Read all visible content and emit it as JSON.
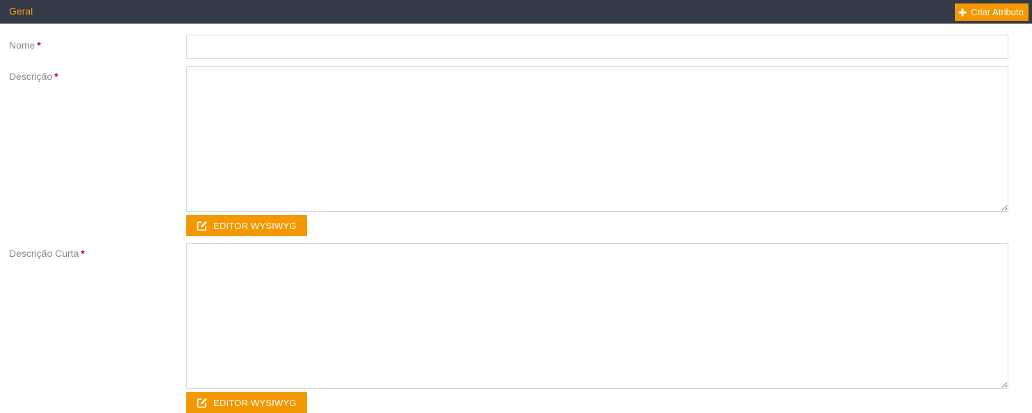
{
  "section": {
    "title": "Geral",
    "create_button_label": "Criar Atributo",
    "create_button_icon": "plus-icon"
  },
  "form": {
    "required_marker": "*",
    "nome": {
      "label": "Nome",
      "value": "",
      "placeholder": ""
    },
    "descricao": {
      "label": "Descrição",
      "value": "",
      "placeholder": "",
      "editor_button_label": "EDITOR WYSIWYG",
      "editor_button_icon": "edit-icon"
    },
    "descricao_curta": {
      "label": "Descrição Curta",
      "value": "",
      "placeholder": "",
      "editor_button_label": "EDITOR WYSIWYG",
      "editor_button_icon": "edit-icon"
    }
  },
  "colors": {
    "header_background": "#343a46",
    "accent": "#f39800",
    "required": "#cc0000"
  }
}
